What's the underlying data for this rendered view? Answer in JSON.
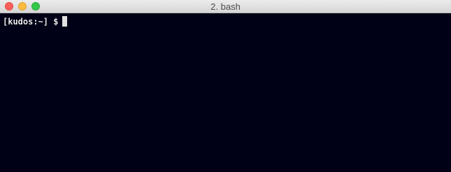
{
  "window": {
    "title": "2. bash"
  },
  "terminal": {
    "prompt": "[kudos:~] $"
  },
  "colors": {
    "background": "#000016",
    "text": "#e8e8e8",
    "close": "#fc605b",
    "minimize": "#fdbc40",
    "zoom": "#34c84a"
  }
}
